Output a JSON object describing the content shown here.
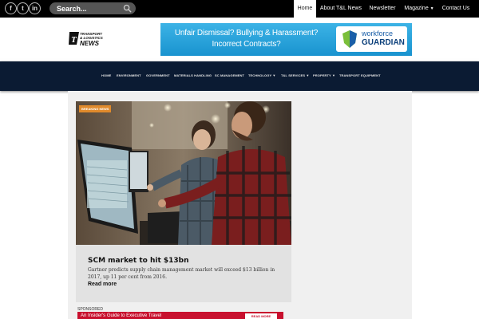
{
  "topbar": {
    "social": [
      {
        "icon": "facebook-icon",
        "glyph": "f"
      },
      {
        "icon": "twitter-icon",
        "glyph": "t"
      },
      {
        "icon": "linkedin-icon",
        "glyph": "in"
      }
    ],
    "search_placeholder": "Search...",
    "nav": [
      {
        "label": "Home",
        "active": true
      },
      {
        "label": "About T&L News",
        "active": false
      },
      {
        "label": "Newsletter",
        "active": false
      },
      {
        "label": "Magazine",
        "active": false,
        "dropdown": true
      },
      {
        "label": "Contact Us",
        "active": false
      }
    ]
  },
  "header": {
    "logo_text": [
      "TRANSPORT",
      "& LOGISTICS",
      "NEWS"
    ],
    "ad": {
      "line1": "Unfair Dismissal?  Bullying & Harassment?",
      "line2": "Incorrect Contracts?",
      "brand_line1": "workforce",
      "brand_line2": "GUARDIAN"
    }
  },
  "mainnav": [
    {
      "label": "HOME"
    },
    {
      "label": "ENVIRONMENT"
    },
    {
      "label": "GOVERNMENT"
    },
    {
      "label": "MATERIALS HANDLING"
    },
    {
      "label": "SC MANAGEMENT"
    },
    {
      "label": "TECHNOLOGY",
      "dropdown": true
    },
    {
      "label": "T&L SERVICES",
      "dropdown": true
    },
    {
      "label": "PROPERTY",
      "dropdown": true
    },
    {
      "label": "TRANSPORT EQUIPMENT"
    }
  ],
  "article": {
    "badge": "BREAKING NEWS",
    "title": "SCM market to hit $13bn",
    "description": "Gartner predicts supply chain management market will exceed $13 billion in 2017, up 11 per cent from 2016.",
    "read_more": "Read more"
  },
  "sponsored": {
    "label": "SPONSORED",
    "headline": "An Insider's Guide to Executive Travel",
    "button": "READ MORE"
  },
  "colors": {
    "topbar_bg": "#000000",
    "mainnav_bg": "#0b1b33",
    "badge": "#e08a2c",
    "ad_blue": "#1993cf",
    "sponsored_red": "#c8102e"
  }
}
